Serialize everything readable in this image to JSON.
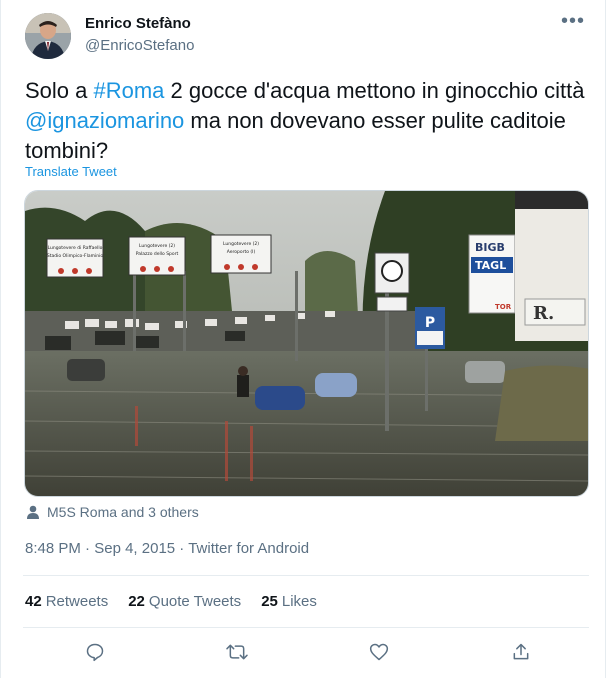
{
  "author": {
    "name": "Enrico Stefàno",
    "handle": "@EnricoStefano"
  },
  "tweet": {
    "text_parts": {
      "p1": "Solo a ",
      "hashtag": "#Roma",
      "p2": " 2 gocce d'acqua mettono in ginocchio città ",
      "mention": "@ignaziomarino",
      "p3": " ma non dovevano esser pulite caditoie tombini?"
    },
    "translate_label": "Translate Tweet"
  },
  "photo": {
    "signs": {
      "sign1_line1": "Lungotevere di Raffaello",
      "sign1_line2": "Stadio Olimpico-Flaminio",
      "sign2_line1": "Lungotevere (2)",
      "sign2_line2": "Palazzo dello Sport",
      "sign3_line1": "Lungotevere (2)",
      "sign3_line2": "Aeroporto (I)",
      "billboard_big": "BIGB",
      "billboard_tagl": "TAGL",
      "billboard_tor": "TOR",
      "parking": "P",
      "store_letter": "R."
    }
  },
  "liked_by": "M5S Roma and 3 others",
  "meta": {
    "time": "8:48 PM",
    "date": "Sep 4, 2015",
    "source": "Twitter for Android"
  },
  "stats": {
    "retweets_count": "42",
    "retweets_label": "Retweets",
    "quotes_count": "22",
    "quotes_label": "Quote Tweets",
    "likes_count": "25",
    "likes_label": "Likes"
  },
  "colors": {
    "link": "#1b95e0",
    "secondary": "#5b7083",
    "primary": "#0f1419"
  },
  "icons": {
    "more": "more-icon",
    "reply": "reply-icon",
    "retweet": "retweet-icon",
    "like": "like-icon",
    "share": "share-icon",
    "person": "person-icon"
  }
}
